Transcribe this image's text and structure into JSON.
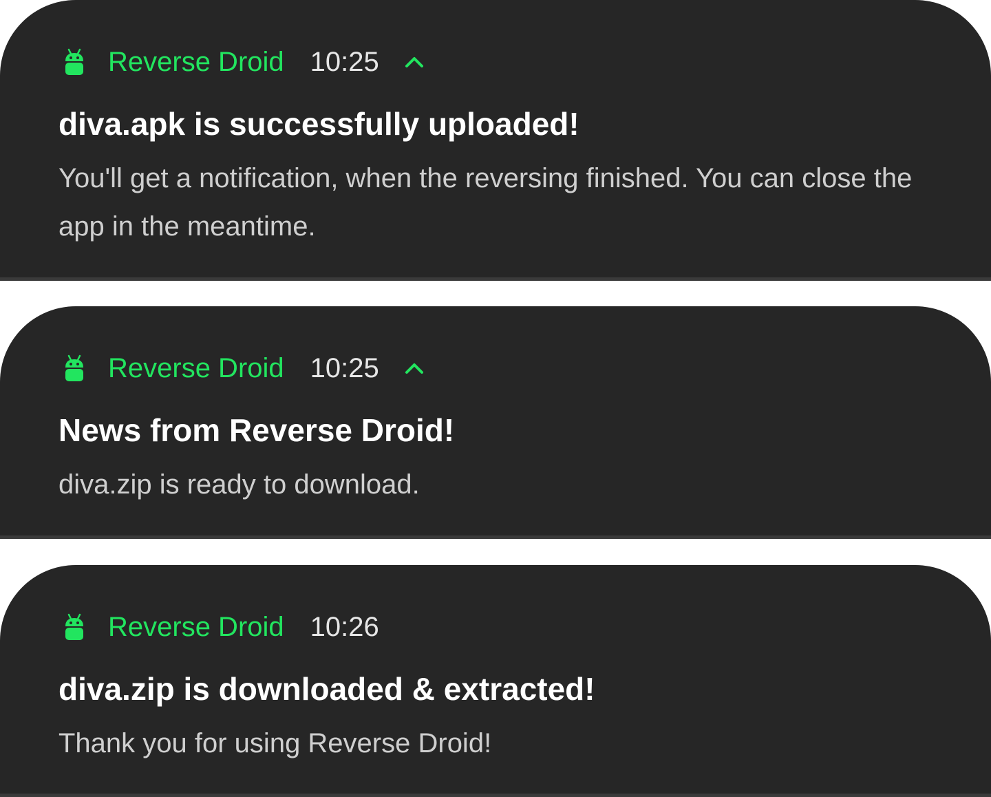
{
  "colors": {
    "app_accent": "#22e55f",
    "card_background": "#262626",
    "title_text": "#ffffff",
    "body_text": "#cfcfcf"
  },
  "notifications": [
    {
      "app_icon": "android-icon",
      "app_name": "Reverse Droid",
      "time": "10:25",
      "expanded": true,
      "title": "diva.apk is successfully uploaded!",
      "body": "You'll get a notification, when the reversing finished. You can close the app in the meantime."
    },
    {
      "app_icon": "android-icon",
      "app_name": "Reverse Droid",
      "time": "10:25",
      "expanded": true,
      "title": "News from Reverse Droid!",
      "body": "diva.zip is ready to download."
    },
    {
      "app_icon": "android-icon",
      "app_name": "Reverse Droid",
      "time": "10:26",
      "expanded": false,
      "title": "diva.zip is downloaded & extracted!",
      "body": "Thank you for using Reverse Droid!"
    }
  ]
}
